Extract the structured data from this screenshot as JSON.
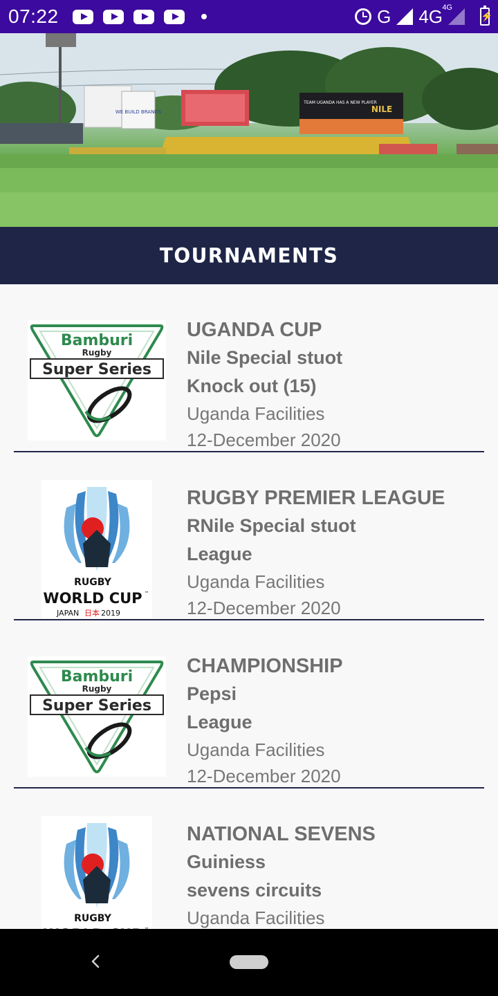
{
  "status_bar": {
    "time": "07:22",
    "network_label": "G",
    "network_4g": "4G",
    "network_4g_sup": "4G",
    "icons": [
      "youtube-icon",
      "youtube-icon",
      "youtube-icon",
      "youtube-icon",
      "notification-dot-icon",
      "alarm-icon",
      "signal-icon",
      "signal-icon",
      "battery-charging-icon"
    ]
  },
  "banner": {
    "billboards": [
      "WE BUILD BRANDS",
      "TEAM UGANDA HAS A NEW PLAYER",
      "NILE"
    ]
  },
  "header": {
    "title": "TOURNAMENTS"
  },
  "tournaments": [
    {
      "title": "UGANDA CUP",
      "sponsor": "Nile Special stuot",
      "type": "Knock out (15)",
      "venue": "Uganda Facilities",
      "date": "12-December 2020",
      "logo": "bamburi"
    },
    {
      "title": "RUGBY PREMIER LEAGUE",
      "sponsor": "RNile Special stuot",
      "type": "League",
      "venue": "Uganda Facilities",
      "date": "12-December 2020",
      "logo": "rwc"
    },
    {
      "title": "CHAMPIONSHIP",
      "sponsor": "Pepsi",
      "type": "League",
      "venue": "Uganda Facilities",
      "date": "12-December 2020",
      "logo": "bamburi"
    },
    {
      "title": "NATIONAL SEVENS",
      "sponsor": "Guiniess",
      "type": "sevens circuits",
      "venue": "Uganda Facilities",
      "date": "",
      "logo": "rwc"
    }
  ],
  "logos": {
    "bamburi": {
      "line1": "Bamburi",
      "line2": "Rugby",
      "line3": "Super Series"
    },
    "rwc": {
      "line1": "RUGBY",
      "line2": "WORLD CUP",
      "tm": "™",
      "line3a": "JAPAN",
      "line3b": "日本",
      "line3c": "2019"
    }
  },
  "colors": {
    "status_bar": "#3c0a9e",
    "header": "#1f2547",
    "divider": "#1f2547",
    "text": "#6e6e6e",
    "bamburi_green": "#2e8a4e",
    "rwc_red": "#e02020"
  }
}
